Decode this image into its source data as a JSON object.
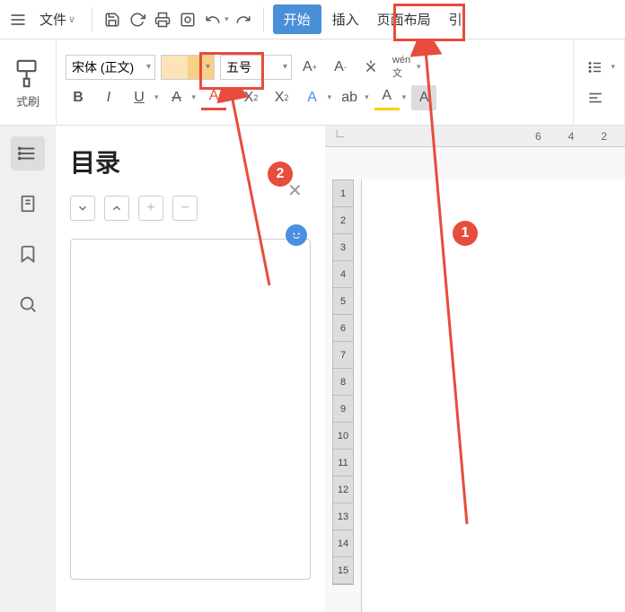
{
  "menubar": {
    "file": "文件",
    "tabs": {
      "start": "开始",
      "insert": "插入",
      "layout": "页面布局",
      "quote": "引"
    }
  },
  "toolbar": {
    "format_painter": "式刷",
    "font_name": "宋体 (正文)",
    "font_size": "五号"
  },
  "panel": {
    "title": "目录"
  },
  "ruler": {
    "h_ticks": [
      "6",
      "4",
      "2"
    ],
    "v_ticks": [
      "1",
      "2",
      "3",
      "4",
      "5",
      "6",
      "7",
      "8",
      "9",
      "10",
      "11",
      "12",
      "13",
      "14",
      "15"
    ]
  },
  "callouts": {
    "one": "1",
    "two": "2"
  }
}
